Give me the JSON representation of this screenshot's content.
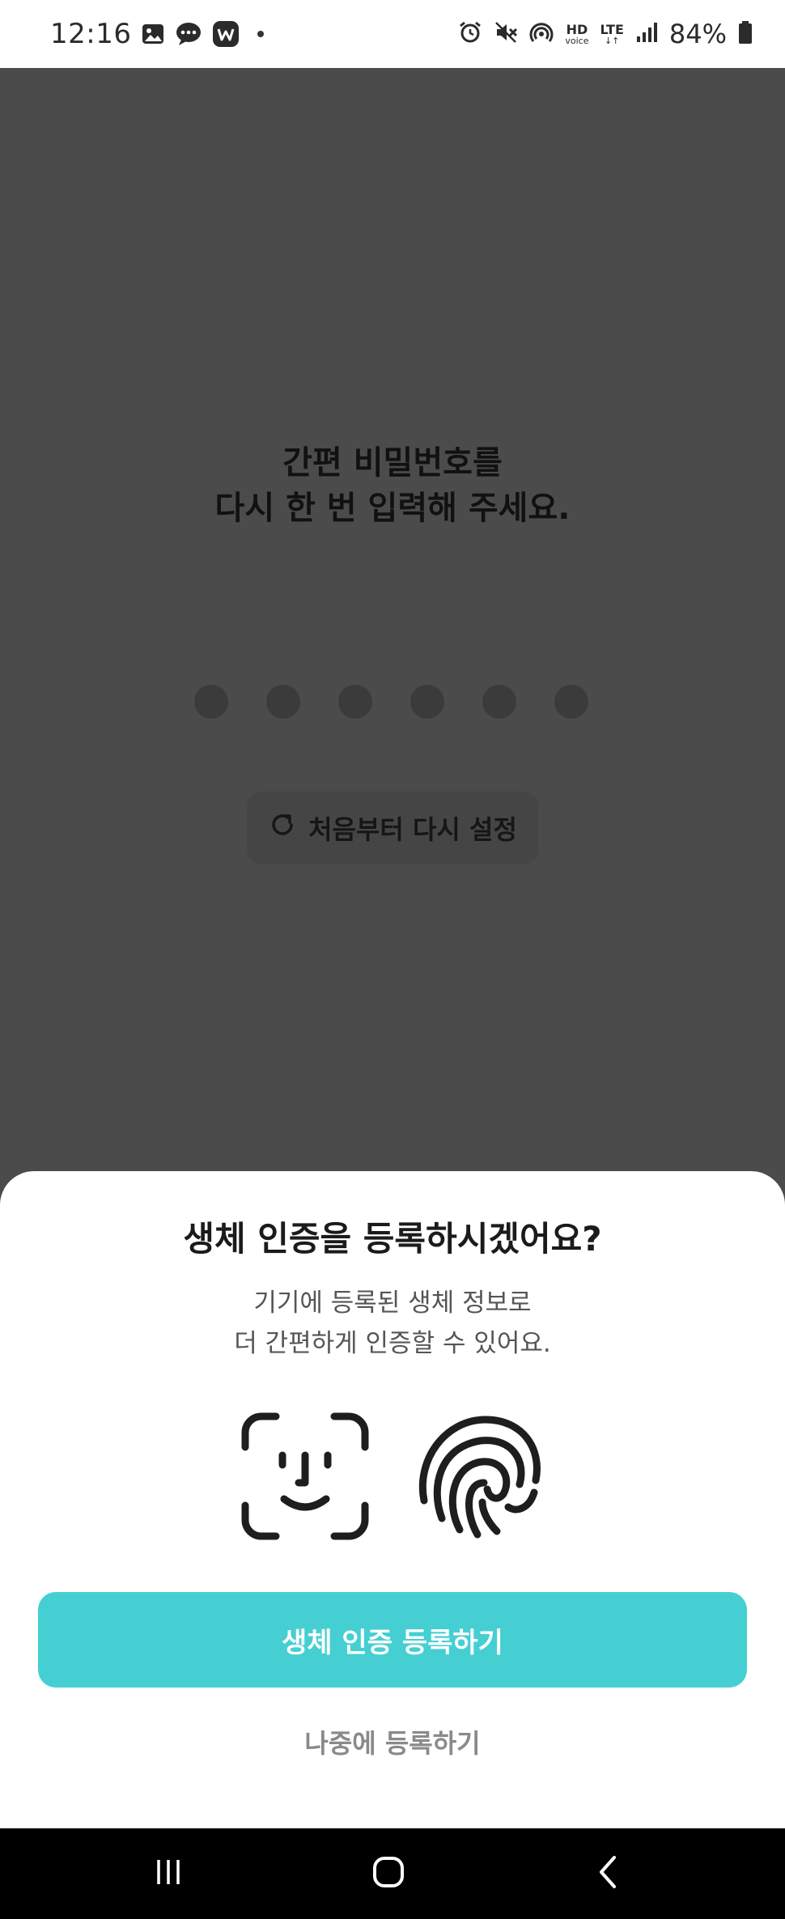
{
  "status_bar": {
    "time": "12:16",
    "hd_label": "HD",
    "voice_label": "voice",
    "lte_label": "LTE",
    "battery": "84%",
    "left_icons": [
      "gallery-icon",
      "chat-icon",
      "w-app-icon"
    ],
    "right_icons": [
      "alarm-icon",
      "mute-icon",
      "hotspot-icon",
      "signal-icon",
      "battery-icon"
    ]
  },
  "pin_screen": {
    "title_line1": "간편 비밀번호를",
    "title_line2": "다시 한 번 입력해 주세요.",
    "pin_length": 6,
    "reset_label": "처음부터 다시 설정"
  },
  "sheet": {
    "title": "생체 인증을 등록하시겠어요?",
    "desc_line1": "기기에 등록된 생체 정보로",
    "desc_line2": "더 간편하게 인증할 수 있어요.",
    "icons": [
      "face-id-icon",
      "fingerprint-icon"
    ],
    "primary_label": "생체 인증 등록하기",
    "secondary_label": "나중에 등록하기"
  },
  "colors": {
    "accent": "#45cfd3",
    "dim_background": "#4b4b4b"
  },
  "nav": {
    "icons": [
      "recent-apps-icon",
      "home-icon",
      "back-icon"
    ]
  }
}
